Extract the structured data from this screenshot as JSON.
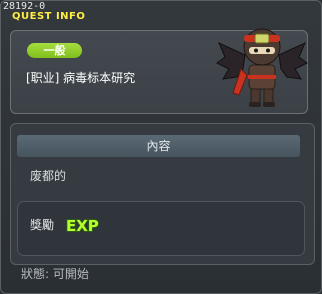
{
  "window": {
    "quest_id": "28192-0",
    "title": "QUEST INFO"
  },
  "quest": {
    "category_tag": "一般",
    "name": "[职业] 病毒标本研究"
  },
  "content": {
    "header": "內容",
    "description": "废都的"
  },
  "reward": {
    "label": "獎勵",
    "icon": "exp-badge-icon",
    "icon_text": "EXP"
  },
  "status": {
    "text": "狀態: 可開始"
  },
  "colors": {
    "title": "#ffee44",
    "tag_green": "#8fcc2a",
    "exp_green": "#b6ff2e"
  }
}
